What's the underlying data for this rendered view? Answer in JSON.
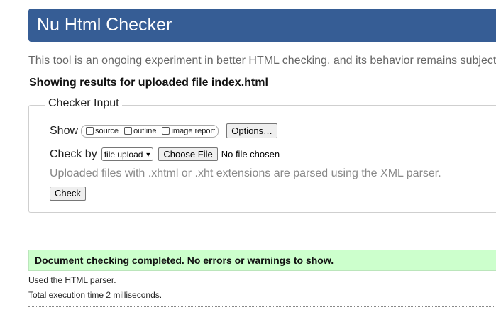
{
  "header": {
    "title": "Nu Html Checker",
    "background_color": "#365d95"
  },
  "intro_text": "This tool is an ongoing experiment in better HTML checking, and its behavior remains subject",
  "results_heading": "Showing results for uploaded file index.html",
  "checker_input": {
    "legend": "Checker Input",
    "show_label": "Show",
    "show_options": [
      {
        "label": "source",
        "checked": false
      },
      {
        "label": "outline",
        "checked": false
      },
      {
        "label": "image report",
        "checked": false
      }
    ],
    "options_button": "Options…",
    "check_by_label": "Check by",
    "check_by_selected": "file upload",
    "choose_file_button": "Choose File",
    "file_status": "No file chosen",
    "hint": "Uploaded files with .xhtml or .xht extensions are parsed using the XML parser.",
    "check_button": "Check"
  },
  "results": {
    "success_message": "Document checking completed. No errors or warnings to show.",
    "success_color": "#ccffcc",
    "parser_note": "Used the HTML parser.",
    "execution_time": "Total execution time 2 milliseconds."
  }
}
